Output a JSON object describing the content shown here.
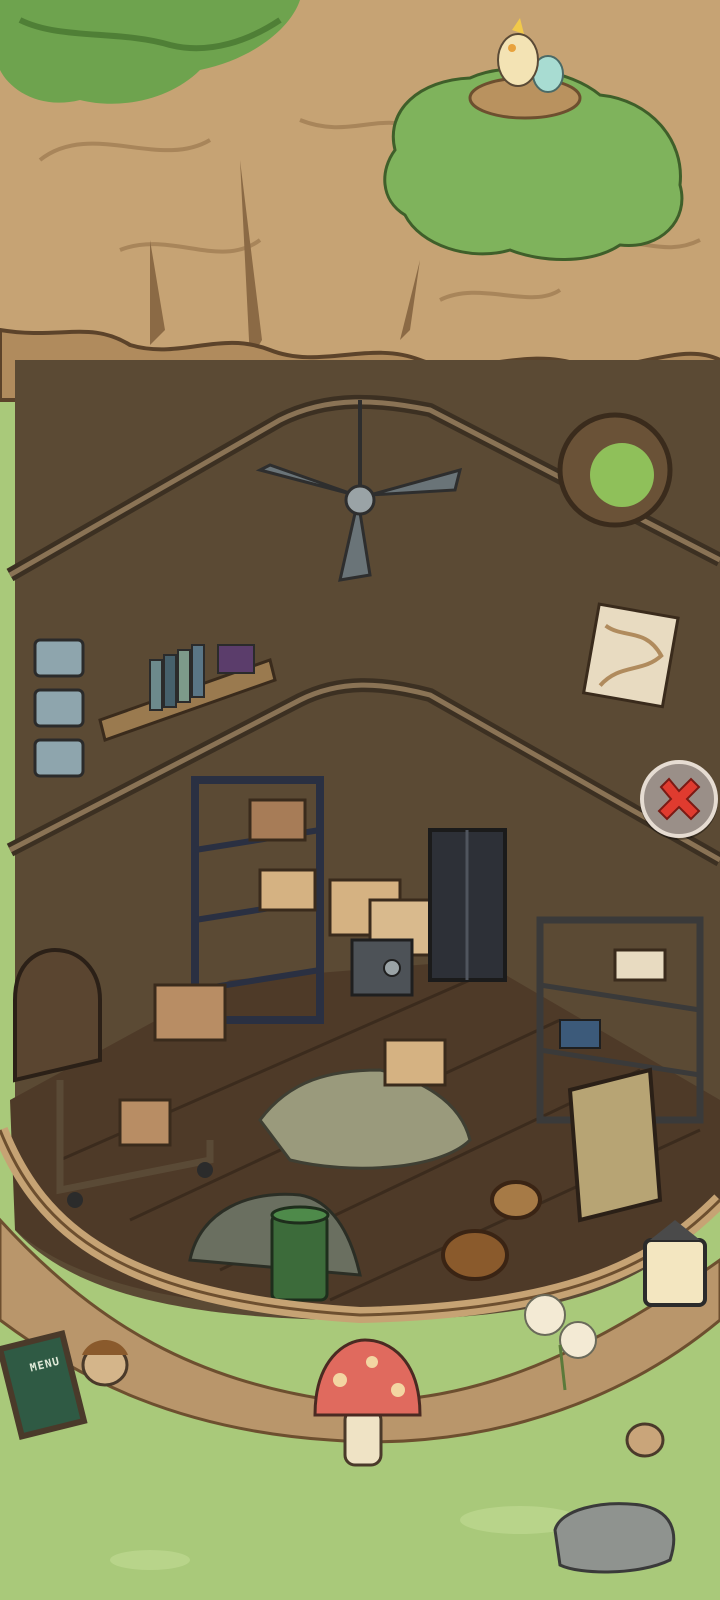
{
  "scene": {
    "name": "treehouse-storage-room",
    "menu_board_text": "MENU",
    "close_button_label": "Close"
  },
  "colors": {
    "grass": "#a9c97a",
    "bark": "#c6a374",
    "bark_dark": "#8b6a45",
    "room_wall": "#5b4a34",
    "floor": "#4e3a28",
    "foliage": "#7fb35c",
    "close_red": "#e03b2f"
  },
  "icons": {
    "close": "x-icon",
    "bird": "bird-icon",
    "ceiling_fan": "ceiling-fan-icon"
  }
}
